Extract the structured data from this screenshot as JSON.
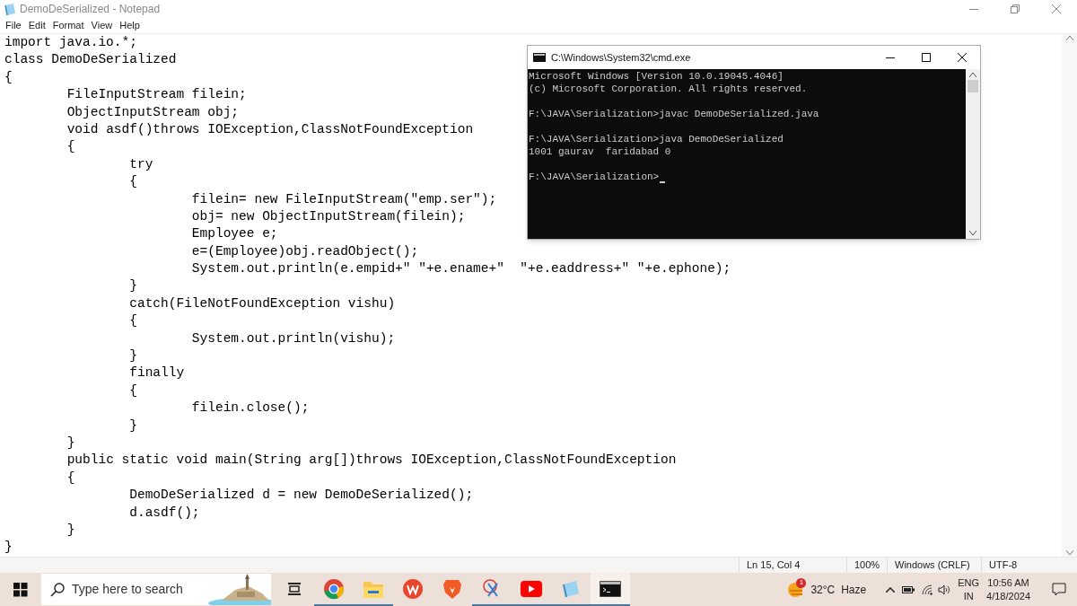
{
  "notepad": {
    "title": "DemoDeSerialized - Notepad",
    "menu": [
      "File",
      "Edit",
      "Format",
      "View",
      "Help"
    ],
    "lines": [
      "import java.io.*;",
      "class DemoDeSerialized",
      "{",
      "\tFileInputStream filein;",
      "\tObjectInputStream obj;",
      "\tvoid asdf()throws IOException,ClassNotFoundException",
      "\t{",
      "\t\ttry",
      "\t\t{",
      "\t\t\tfilein= new FileInputStream(\"emp.ser\");",
      "\t\t\tobj= new ObjectInputStream(filein);",
      "\t\t\tEmployee e;",
      "\t\t\te=(Employee)obj.readObject();",
      "\t\t\tSystem.out.println(e.empid+\" \"+e.ename+\"  \"+e.eaddress+\" \"+e.ephone);",
      "\t\t}",
      "\t\tcatch(FileNotFoundException vishu)",
      "\t\t{",
      "\t\t\tSystem.out.println(vishu);",
      "\t\t}",
      "\t\tfinally",
      "\t\t{",
      "\t\t\tfilein.close();",
      "\t\t}",
      "\t}",
      "\tpublic static void main(String arg[])throws IOException,ClassNotFoundException",
      "\t{",
      "\t\tDemoDeSerialized d = new DemoDeSerialized();",
      "\t\td.asdf();",
      "\t}",
      "}"
    ],
    "status_bar": [
      "Ln 15, Col 4",
      "100%",
      "Windows (CRLF)",
      "UTF-8"
    ]
  },
  "cmd": {
    "title": "C:\\Windows\\System32\\cmd.exe",
    "blocks": [
      [
        "Microsoft Windows [Version 10.0.19045.4046]",
        "(c) Microsoft Corporation. All rights reserved."
      ],
      [
        "F:\\JAVA\\Serialization>javac DemoDeSerialized.java"
      ],
      [
        "F:\\JAVA\\Serialization>java DemoDeSerialized",
        "1001 gaurav  faridabad 0"
      ],
      [
        "F:\\JAVA\\Serialization>"
      ]
    ]
  },
  "taskbar": {
    "search": {
      "placeholder": "Type here to search"
    },
    "apps": [
      {
        "kind": "taskview",
        "running": false,
        "selected": false
      },
      {
        "kind": "chrome",
        "running": true,
        "selected": false
      },
      {
        "kind": "explorer",
        "running": true,
        "selected": false
      },
      {
        "kind": "wps",
        "running": false,
        "selected": false
      },
      {
        "kind": "brave",
        "running": false,
        "selected": false
      },
      {
        "kind": "snip",
        "running": true,
        "selected": false
      },
      {
        "kind": "youtube",
        "running": true,
        "selected": false
      },
      {
        "kind": "notepad",
        "running": true,
        "selected": false
      },
      {
        "kind": "cmd",
        "running": true,
        "selected": true
      }
    ],
    "weather": {
      "badge": "1",
      "temperature": "32°C",
      "condition": "Haze"
    },
    "language": [
      "ENG",
      "IN"
    ],
    "time": "10:56 AM",
    "date": "4/18/2024"
  }
}
